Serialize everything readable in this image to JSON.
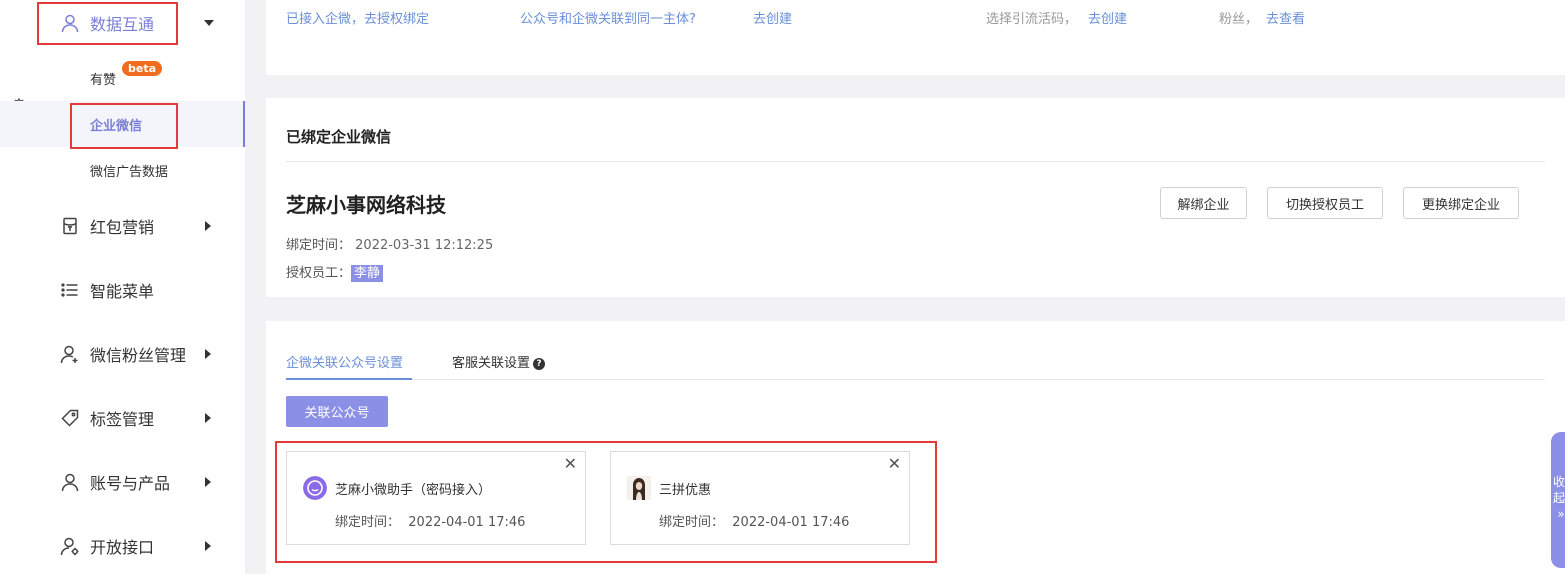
{
  "sidebar": {
    "menu": [
      {
        "label": "数据互通",
        "icon": "user-icon"
      },
      {
        "label": "红包营销",
        "icon": "red-packet-icon"
      },
      {
        "label": "智能菜单",
        "icon": "menu-list-icon"
      },
      {
        "label": "微信粉丝管理",
        "icon": "user-add-icon"
      },
      {
        "label": "标签管理",
        "icon": "tag-icon"
      },
      {
        "label": "账号与产品",
        "icon": "user-icon"
      },
      {
        "label": "开放接口",
        "icon": "user-settings-icon"
      }
    ],
    "sub_items": [
      {
        "label": "有赞",
        "badge": "beta"
      },
      {
        "label": "企业微信"
      },
      {
        "label": "微信广告数据"
      }
    ]
  },
  "top_card": {
    "link1": "已接入企微，去授权绑定",
    "link2": "公众号和企微关联到同一主体?",
    "link3": "去创建",
    "text4": "选择引流活码，",
    "link4": "去创建",
    "text5": "粉丝，",
    "link5": "去查看"
  },
  "bind": {
    "title": "已绑定企业微信",
    "company": "芝麻小事网络科技",
    "bind_time_label": "绑定时间：",
    "bind_time": "2022-03-31 12:12:25",
    "staff_label": "授权员工：",
    "staff": "李静",
    "buttons": {
      "unbind": "解绑企业",
      "switch_staff": "切换授权员工",
      "change": "更换绑定企业"
    }
  },
  "tabs": {
    "tab1": "企微关联公众号设置",
    "tab2": "客服关联设置",
    "link_button": "关联公众号",
    "accounts": [
      {
        "name": "芝麻小微助手（密码接入）",
        "time_label": "绑定时间：",
        "time": "2022-04-01 17:46"
      },
      {
        "name": "三拼优惠",
        "time_label": "绑定时间：",
        "time": "2022-04-01 17:46"
      }
    ]
  },
  "float_tab": {
    "label": "收起",
    "arrow": "»"
  },
  "colors": {
    "accent": "#8b8fe6",
    "link": "#6a8fd8",
    "highlight_box": "#e03a3a",
    "beta": "#f06d20"
  }
}
